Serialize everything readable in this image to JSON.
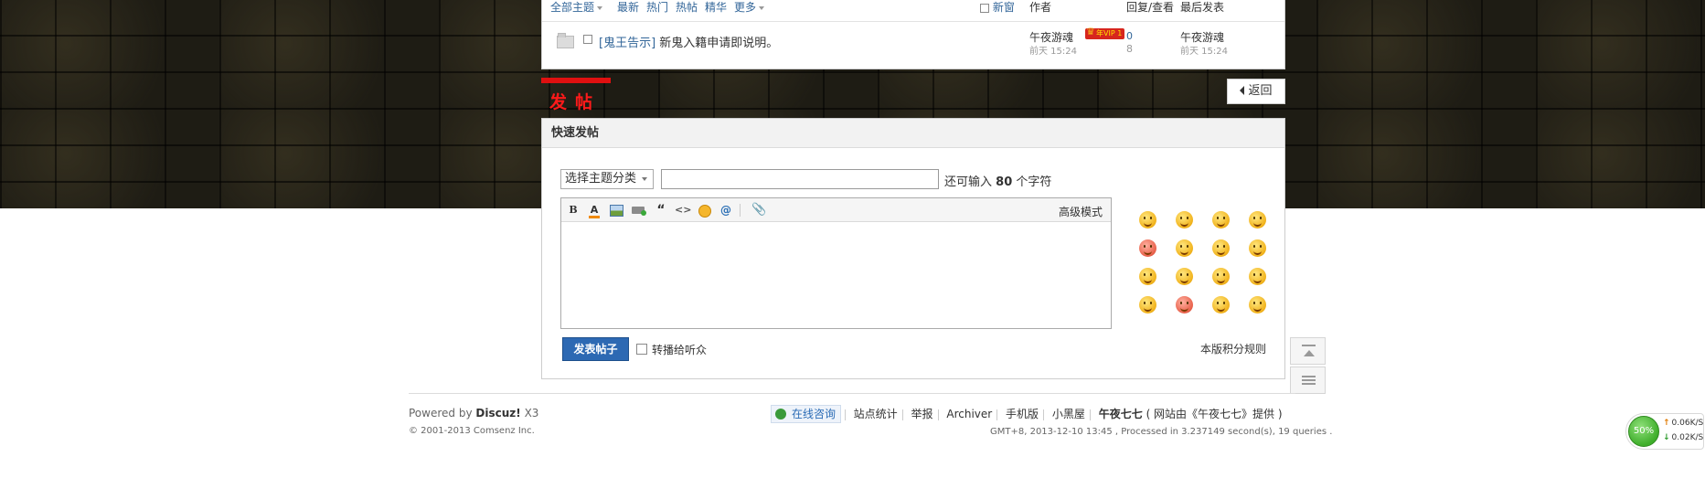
{
  "thread_list": {
    "tabs": [
      "全部主题",
      "最新",
      "热门",
      "热帖",
      "精华",
      "更多"
    ],
    "new_window_label": "新窗",
    "col_author": "作者",
    "col_replies": "回复/查看",
    "col_last": "最后发表",
    "thread": {
      "category": "[鬼王告示]",
      "title": "新鬼入籍申请即说明。",
      "author": "午夜游魂",
      "author_date": "前天 15:24",
      "vip_badge": "年VIP 1",
      "replies": "0",
      "views": "8",
      "last_author": "午夜游魂",
      "last_date": "前天 15:24"
    }
  },
  "post_button_label": "发帖",
  "back_button_label": "返回",
  "quick_post": {
    "header": "快速发帖",
    "type_select_value": "选择主题分类",
    "title_placeholder": "",
    "chars_prefix": "还可输入",
    "chars_remaining": "80",
    "chars_suffix": "个字符",
    "toolbar": {
      "bold": "B",
      "color": "A",
      "quote": "“",
      "code": "<>",
      "at": "@",
      "attach": "📎",
      "advanced_mode": "高级模式"
    },
    "submit_label": "发表帖子",
    "broadcast_label": "转播给听众",
    "credit_rule_label": "本版积分规则"
  },
  "footer": {
    "powered_prefix": "Powered by",
    "powered_brand": "Discuz!",
    "powered_version": "X3",
    "copyright": "© 2001-2013 Comsenz Inc.",
    "online_consult": "在线咨询",
    "links": [
      "站点统计",
      "举报",
      "Archiver",
      "手机版",
      "小黑屋"
    ],
    "site_name": "午夜七七",
    "site_credit": "( 网站由《午夜七七》提供 )",
    "gmt_info": "GMT+8, 2013-12-10 13:45 , Processed in 3.237149 second(s), 19 queries ."
  },
  "network": {
    "percent": "50%",
    "upload": "0.06K/S",
    "download": "0.02K/S"
  },
  "colors": {
    "link_blue": "#336699",
    "post_red": "#ff1a1a",
    "submit_blue": "#2d69b3"
  }
}
